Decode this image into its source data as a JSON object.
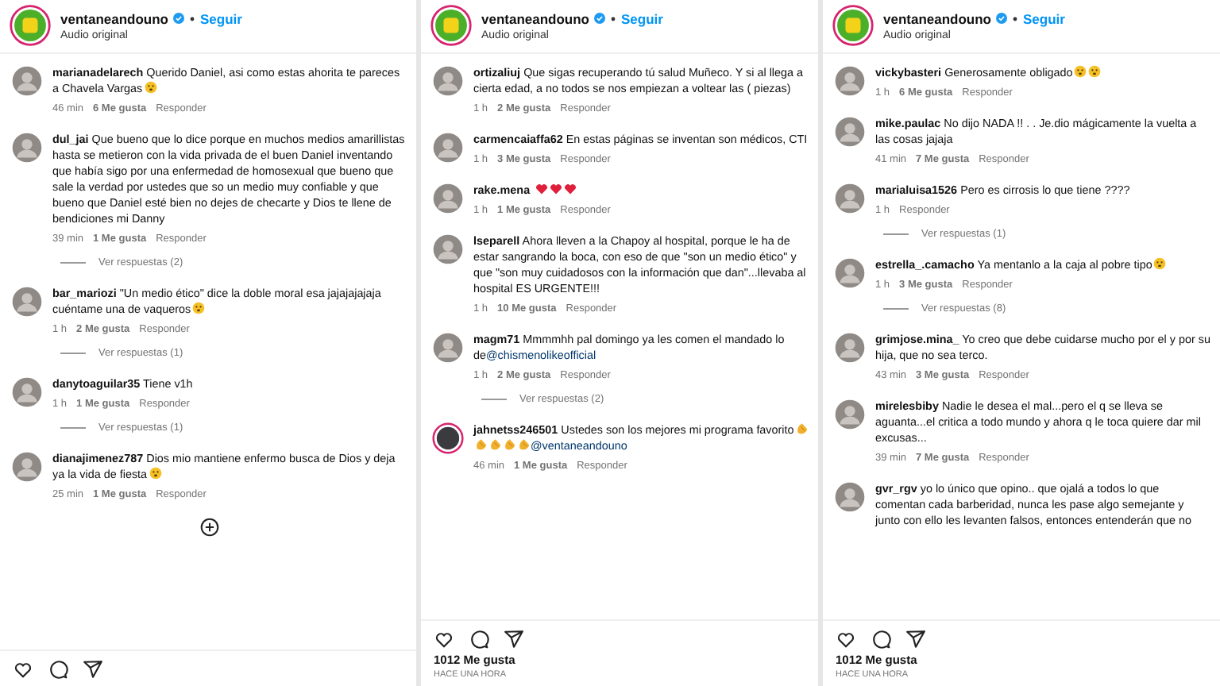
{
  "panels": [
    {
      "header": {
        "user": "ventaneandouno",
        "follow": "Seguir",
        "subtitle": "Audio original"
      },
      "comments": [
        {
          "user": "marianadelarech",
          "text": "Querido Daniel, asi como estas ahorita te pareces a Chavela Vargas",
          "reactions": [
            {
              "kind": "face"
            }
          ],
          "time": "46 min",
          "likes": "6 Me gusta",
          "reply": "Responder"
        },
        {
          "user": "dul_jai",
          "text": "Que bueno que lo dice porque en muchos medios amarillistas hasta se metieron con la vida privada de el buen Daniel inventando que había sigo por una enfermedad de homosexual que bueno que sale la verdad por ustedes que so un medio muy confiable y que bueno que Daniel esté bien no dejes de checarte y Dios te llene de bendiciones mi Danny",
          "time": "39 min",
          "likes": "1 Me gusta",
          "reply": "Responder",
          "replies": "Ver respuestas (2)"
        },
        {
          "user": "bar_mariozi",
          "text": "\"Un medio ético\" dice la doble moral esa jajajajajaja cuéntame una de vaqueros",
          "reactions": [
            {
              "kind": "face"
            }
          ],
          "time": "1 h",
          "likes": "2 Me gusta",
          "reply": "Responder",
          "replies": "Ver respuestas (1)"
        },
        {
          "user": "danytoaguilar35",
          "text": "Tiene v1h",
          "time": "1 h",
          "likes": "1 Me gusta",
          "reply": "Responder",
          "replies": "Ver respuestas (1)"
        },
        {
          "user": "dianajimenez787",
          "text": "Dios mio mantiene enfermo busca de Dios y deja ya la vida de fiesta",
          "reactions": [
            {
              "kind": "face"
            }
          ],
          "time": "25 min",
          "likes": "1 Me gusta",
          "reply": "Responder"
        }
      ],
      "load_more": true
    },
    {
      "header": {
        "user": "ventaneandouno",
        "follow": "Seguir",
        "subtitle": "Audio original"
      },
      "comments": [
        {
          "user": "ortizaliuj",
          "text": "Que sigas recuperando tú salud Muñeco. Y si al llega a cierta edad, a no todos se nos empiezan a voltear las ( piezas)",
          "time": "1 h",
          "likes": "2 Me gusta",
          "reply": "Responder"
        },
        {
          "user": "carmencaiaffa62",
          "text": "En estas páginas se inventan son médicos, CTI",
          "time": "1 h",
          "likes": "3 Me gusta",
          "reply": "Responder"
        },
        {
          "user": "rake.mena",
          "reactions": [
            {
              "kind": "heart"
            },
            {
              "kind": "heart"
            },
            {
              "kind": "heart"
            }
          ],
          "time": "1 h",
          "likes": "1 Me gusta",
          "reply": "Responder"
        },
        {
          "user": "lseparell",
          "text": "Ahora lleven a la Chapoy al hospital, porque le ha de estar sangrando la boca, con eso de que \"son un medio ético\" y que \"son muy cuidadosos con la información que dan\"...llevaba al hospital ES URGENTE!!!",
          "time": "1 h",
          "likes": "10 Me gusta",
          "reply": "Responder"
        },
        {
          "user": "magm71",
          "text": "Mmmmhh pal domingo ya les comen el mandado lo de",
          "mention": "@chismenolikeofficial",
          "time": "1 h",
          "likes": "2 Me gusta",
          "reply": "Responder",
          "replies": "Ver respuestas (2)"
        },
        {
          "user": "jahnetss246501",
          "text": "Ustedes son los mejores mi programa favorito",
          "reactions": [
            {
              "kind": "clap"
            },
            {
              "kind": "clap"
            },
            {
              "kind": "clap"
            },
            {
              "kind": "clap"
            },
            {
              "kind": "clap"
            }
          ],
          "mention": "@ventaneandouno",
          "story_ring": true,
          "time": "46 min",
          "likes": "1 Me gusta",
          "reply": "Responder"
        }
      ],
      "likes_total": "1012 Me gusta",
      "posted": "HACE UNA HORA"
    },
    {
      "header": {
        "user": "ventaneandouno",
        "follow": "Seguir",
        "subtitle": "Audio original"
      },
      "comments": [
        {
          "user": "vickybasteri",
          "text": "Generosamente obligado",
          "reactions": [
            {
              "kind": "face"
            },
            {
              "kind": "face"
            }
          ],
          "time": "1 h",
          "likes": "6 Me gusta",
          "reply": "Responder"
        },
        {
          "user": "mike.paulac",
          "text": "No dijo NADA !! . . Je.dio mágicamente la vuelta a las cosas jajaja",
          "time": "41 min",
          "likes": "7 Me gusta",
          "reply": "Responder"
        },
        {
          "user": "marialuisa1526",
          "text": "Pero es cirrosis lo que tiene ????",
          "time": "1 h",
          "reply": "Responder",
          "replies": "Ver respuestas (1)"
        },
        {
          "user": "estrella_.camacho",
          "text": "Ya mentanlo a la caja al pobre tipo",
          "reactions": [
            {
              "kind": "face"
            }
          ],
          "time": "1 h",
          "likes": "3 Me gusta",
          "reply": "Responder",
          "replies": "Ver respuestas (8)"
        },
        {
          "user": "grimjose.mina_",
          "text": "Yo creo que debe cuidarse mucho por el y por su hija, que no sea terco.",
          "time": "43 min",
          "likes": "3 Me gusta",
          "reply": "Responder"
        },
        {
          "user": "mirelesbiby",
          "text": "Nadie le desea el mal...pero el q se lleva se aguanta...el critica a todo mundo y ahora q le toca quiere dar mil excusas...",
          "time": "39 min",
          "likes": "7 Me gusta",
          "reply": "Responder"
        },
        {
          "user": "gvr_rgv",
          "text": "yo lo único que opino.. que ojalá a todos lo que comentan cada barberidad, nunca les pase algo semejante y junto con ello les levanten falsos, entonces entenderán que no"
        }
      ],
      "likes_total": "1012 Me gusta",
      "posted": "HACE UNA HORA"
    }
  ]
}
